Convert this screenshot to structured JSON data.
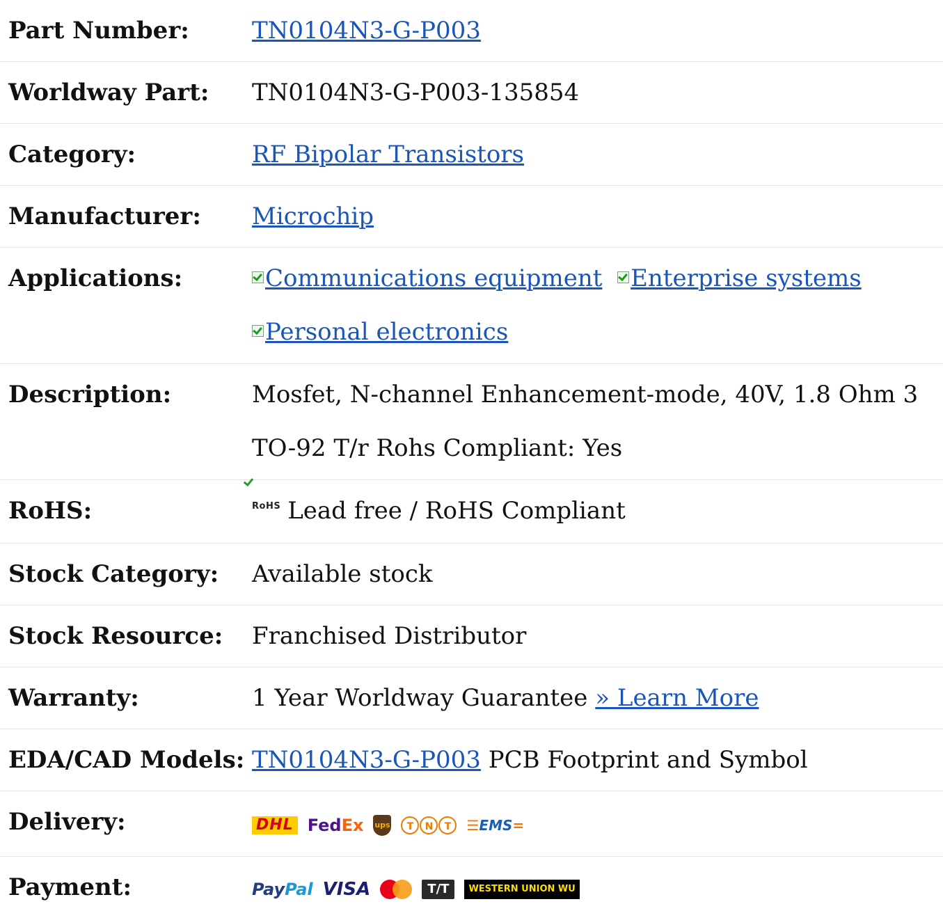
{
  "rows": {
    "part_number": {
      "label": "Part Number:",
      "value": "TN0104N3-G-P003"
    },
    "worldway_part": {
      "label": "Worldway Part:",
      "value": "TN0104N3-G-P003-135854"
    },
    "category": {
      "label": "Category:",
      "value": "RF Bipolar Transistors"
    },
    "manufacturer": {
      "label": "Manufacturer:",
      "value": "Microchip"
    },
    "applications": {
      "label": "Applications:",
      "items": [
        "Communications equipment",
        "Enterprise systems",
        "Personal electronics"
      ]
    },
    "description": {
      "label": "Description:",
      "value": "Mosfet, N-channel Enhancement-mode, 40V, 1.8 Ohm 3 TO-92 T/r Rohs Compliant: Yes"
    },
    "rohs": {
      "label": "RoHS:",
      "icon_text": "RoHS",
      "value": "Lead free / RoHS Compliant"
    },
    "stock_category": {
      "label": "Stock Category:",
      "value": "Available stock"
    },
    "stock_resource": {
      "label": "Stock Resource:",
      "value": "Franchised Distributor"
    },
    "warranty": {
      "label": "Warranty:",
      "value": "1 Year Worldway Guarantee",
      "link": "» Learn More"
    },
    "eda_cad": {
      "label": "EDA/CAD Models:",
      "link": "TN0104N3-G-P003",
      "suffix": "PCB Footprint and Symbol"
    },
    "delivery": {
      "label": "Delivery:",
      "logos": {
        "dhl": "DHL",
        "fedex_a": "Fed",
        "fedex_b": "Ex",
        "ups": "ups",
        "tnt": [
          "T",
          "N",
          "T"
        ],
        "ems": "EMS"
      }
    },
    "payment": {
      "label": "Payment:",
      "logos": {
        "paypal_a": "Pay",
        "paypal_b": "Pal",
        "visa": "VISA",
        "tt": "T/T",
        "wu": "WESTERN UNION WU"
      }
    }
  },
  "colors": {
    "link": "#1a56b8",
    "divider": "#e3e3e3"
  }
}
